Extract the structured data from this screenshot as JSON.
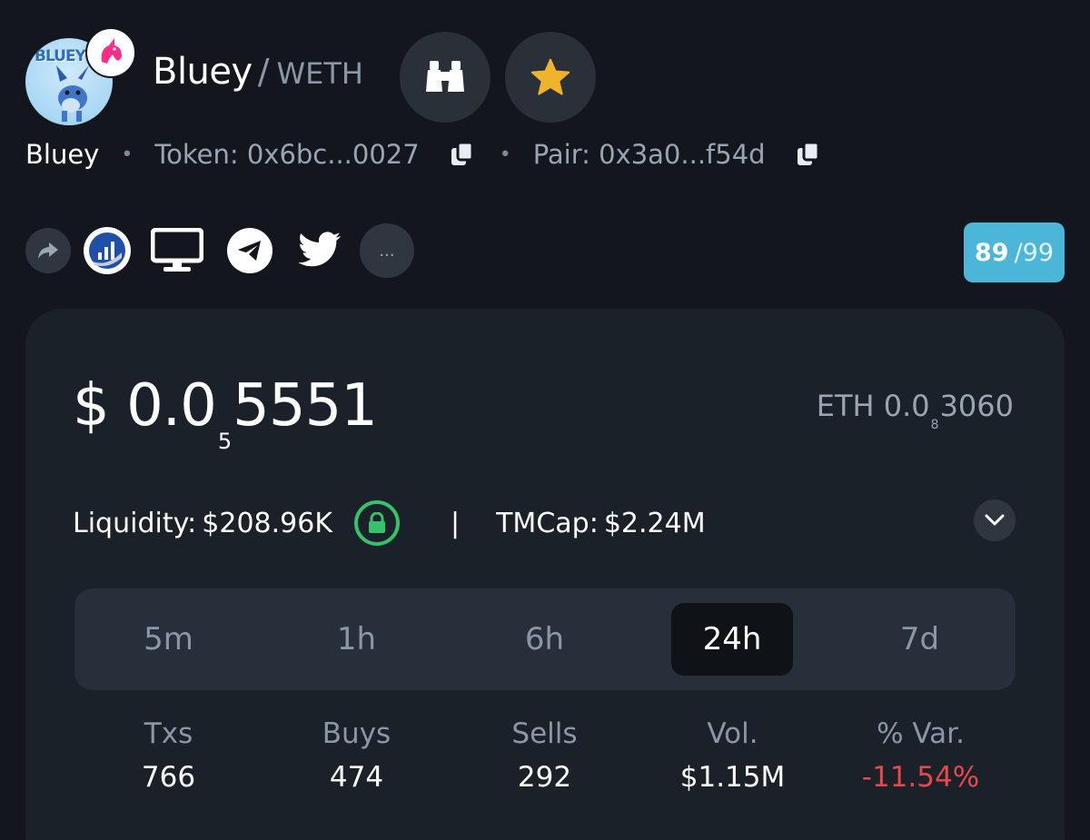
{
  "token": {
    "avatar_text": "BLUEY",
    "base_symbol": "Bluey",
    "quote_symbol": "WETH",
    "name": "Bluey",
    "token_address": "Token: 0x6bc...0027",
    "pair_address": "Pair: 0x3a0...f54d"
  },
  "actions": {
    "binoculars_icon": "binoculars-icon",
    "favorite_icon": "star-icon"
  },
  "social": {
    "icons": [
      "share-icon",
      "chart-logo-icon",
      "website-icon",
      "telegram-icon",
      "twitter-icon"
    ],
    "more_label": "...",
    "score": "89",
    "score_max": "/99"
  },
  "price": {
    "currency": "$",
    "prefix": "0.0",
    "zero_count": "5",
    "digits": "5551",
    "eth_label": "ETH",
    "eth_prefix": "0.0",
    "eth_zero_count": "8",
    "eth_digits": "3060"
  },
  "stats": {
    "liquidity_label": "Liquidity:",
    "liquidity_value": "$208.96K",
    "separator": "|",
    "tmcap_label": "TMCap:",
    "tmcap_value": "$2.24M"
  },
  "timeframes": [
    {
      "label": "5m",
      "active": false
    },
    {
      "label": "1h",
      "active": false
    },
    {
      "label": "6h",
      "active": false
    },
    {
      "label": "24h",
      "active": true
    },
    {
      "label": "7d",
      "active": false
    }
  ],
  "metrics": [
    {
      "label": "Txs",
      "value": "766"
    },
    {
      "label": "Buys",
      "value": "474"
    },
    {
      "label": "Sells",
      "value": "292"
    },
    {
      "label": "Vol.",
      "value": "$1.15M"
    },
    {
      "label": "% Var.",
      "value": "-11.54%"
    }
  ],
  "colors": {
    "background": "#13171d",
    "card": "#1b2129",
    "accent_score": "#4cb6d9",
    "star": "#f2b32c",
    "lock_green": "#35c26b",
    "negative": "#e5484d"
  }
}
